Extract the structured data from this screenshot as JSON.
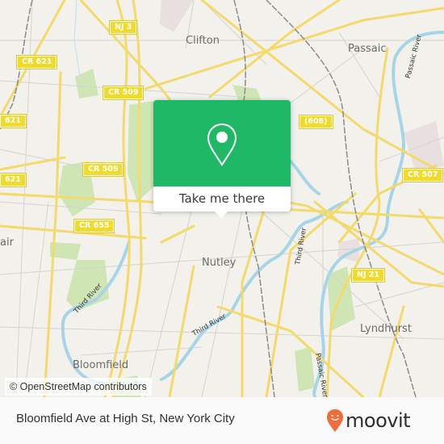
{
  "map": {
    "places": [
      {
        "id": "clifton",
        "label": "Clifton"
      },
      {
        "id": "passaic",
        "label": "Passaic"
      },
      {
        "id": "nutley",
        "label": "Nutley"
      },
      {
        "id": "lyndhurst",
        "label": "Lyndhurst"
      },
      {
        "id": "bloomfield",
        "label": "Bloomfield"
      },
      {
        "id": "montclair-partial",
        "label": "air"
      }
    ],
    "road_shields": [
      {
        "id": "nj3",
        "label": "NJ 3"
      },
      {
        "id": "cr621-a",
        "label": "CR 621"
      },
      {
        "id": "cr621-b",
        "label": "621"
      },
      {
        "id": "cr621-c",
        "label": "621"
      },
      {
        "id": "cr509-a",
        "label": "CR 509"
      },
      {
        "id": "cr509-b",
        "label": "CR 509"
      },
      {
        "id": "cr655",
        "label": "CR 655"
      },
      {
        "id": "r608",
        "label": "(608)"
      },
      {
        "id": "cr507",
        "label": "CR 507"
      },
      {
        "id": "nj21",
        "label": "NJ 21"
      }
    ],
    "water_labels": [
      {
        "id": "third-river-1",
        "label": "Third River"
      },
      {
        "id": "third-river-2",
        "label": "Third River"
      },
      {
        "id": "third-river-3",
        "label": "Third River"
      },
      {
        "id": "passaic-river-1",
        "label": "Passaic River"
      },
      {
        "id": "passaic-river-2",
        "label": "Passaic River"
      }
    ],
    "attribution": "© OpenStreetMap contributors"
  },
  "popup": {
    "icon": "map-pin-icon",
    "button_label": "Take me there",
    "color": "#1fb866"
  },
  "footer": {
    "stop_name": "Bloomfield Ave at High St, New York City",
    "logo_text": "moovit",
    "logo_color": "#f26b3a"
  }
}
